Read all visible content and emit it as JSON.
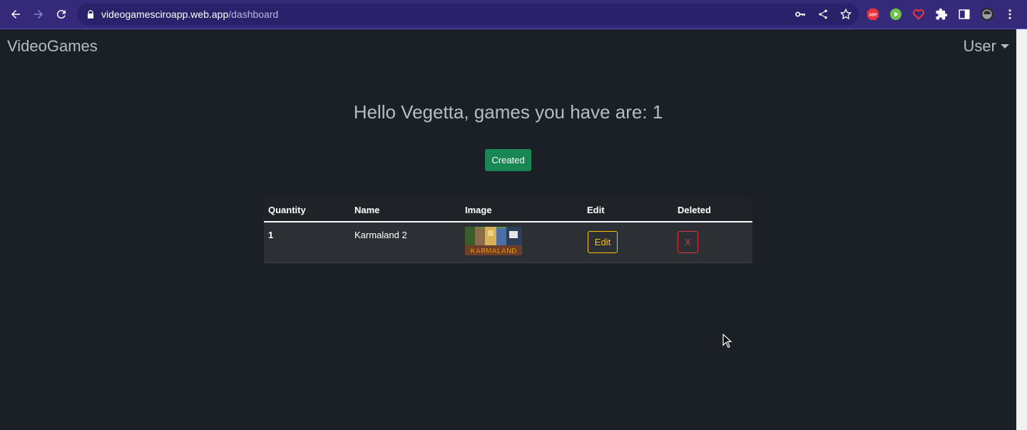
{
  "browser": {
    "url_host": "videogamesciroapp.web.app",
    "url_path": "/dashboard"
  },
  "navbar": {
    "brand": "VideoGames",
    "user_menu": "User"
  },
  "dashboard": {
    "greeting": "Hello Vegetta, games you have are: 1",
    "created_button": "Created"
  },
  "table": {
    "headers": {
      "quantity": "Quantity",
      "name": "Name",
      "image": "Image",
      "edit": "Edit",
      "deleted": "Deleted"
    },
    "rows": [
      {
        "quantity": "1",
        "name": "Karmaland 2",
        "image_caption": "KARMALAND",
        "edit_label": "Edit",
        "delete_label": "X"
      }
    ]
  },
  "colors": {
    "page_bg": "#1b2027",
    "chrome_bg": "#35297a",
    "created_green": "#198754",
    "edit_yellow": "#ffc107",
    "delete_red": "#dc3545"
  }
}
